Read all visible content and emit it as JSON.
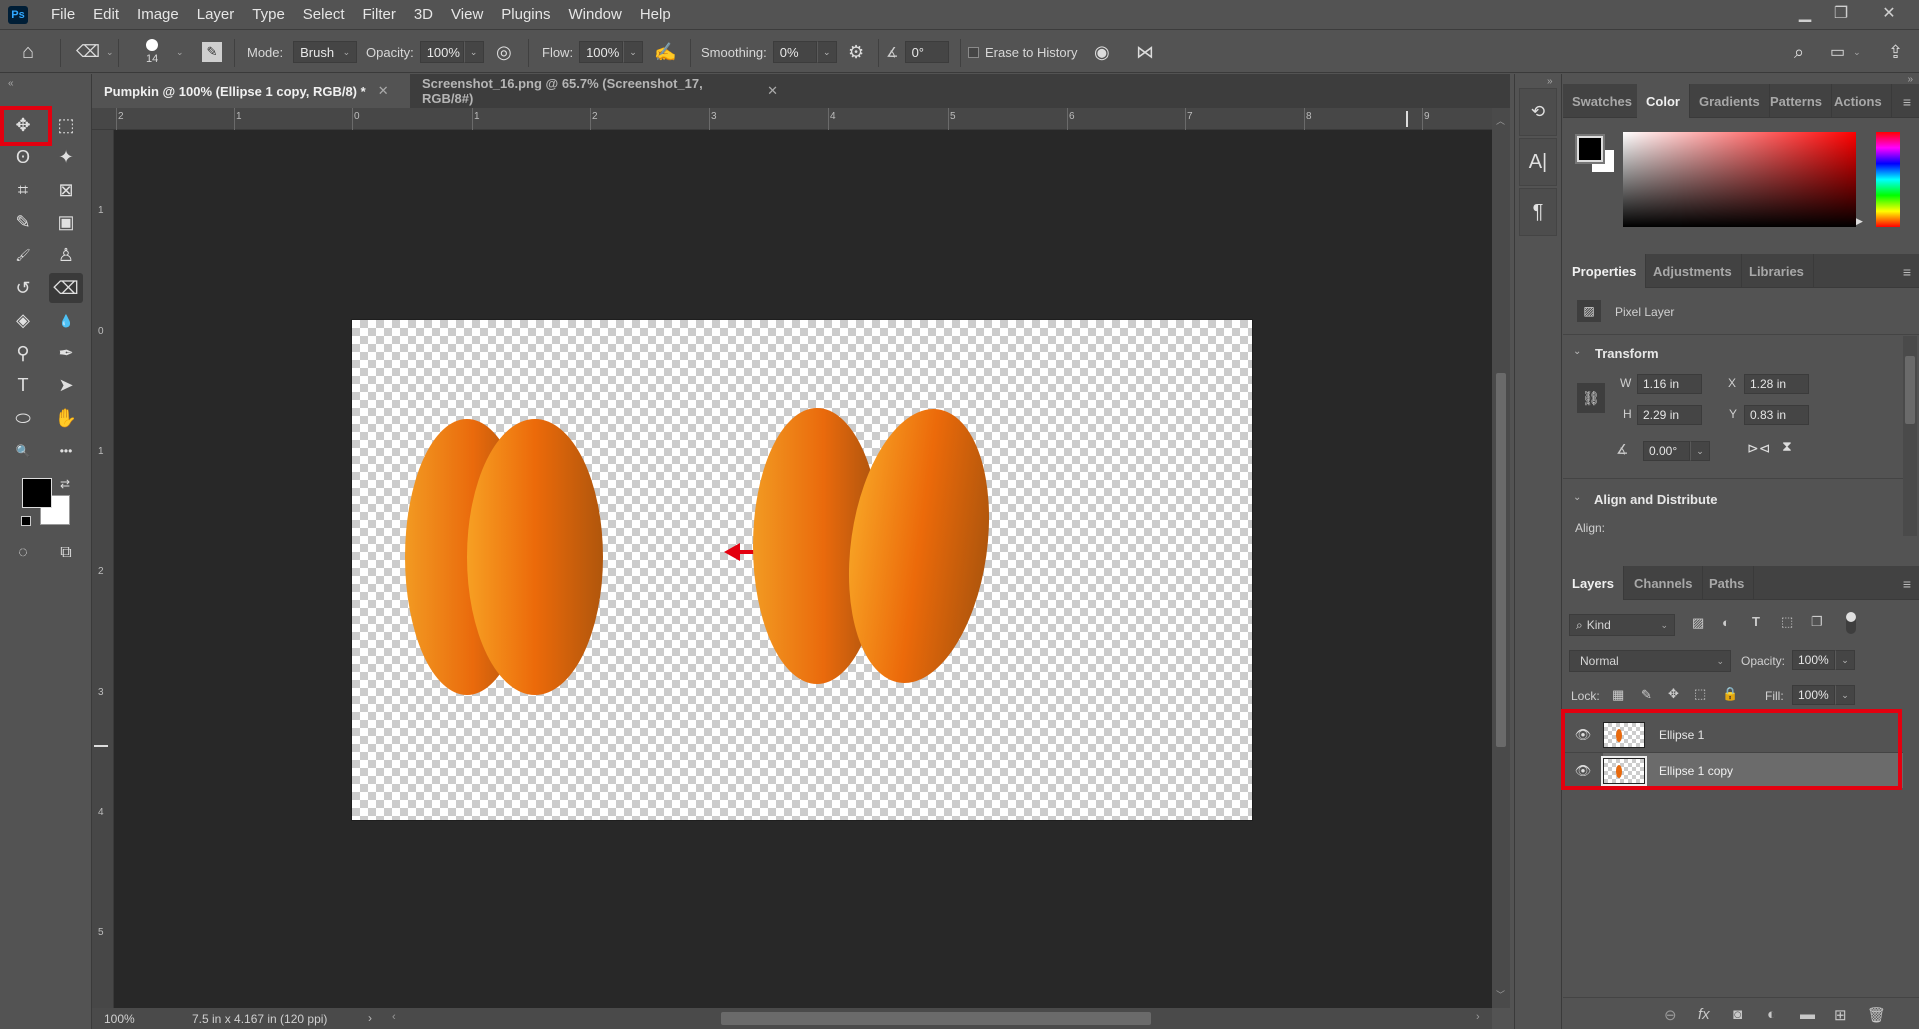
{
  "app": {
    "name": "Photoshop",
    "logo": "Ps"
  },
  "menu": [
    "File",
    "Edit",
    "Image",
    "Layer",
    "Type",
    "Select",
    "Filter",
    "3D",
    "View",
    "Plugins",
    "Window",
    "Help"
  ],
  "window_controls": {
    "minimize": "minimize-icon",
    "restore": "restore-icon",
    "close": "close-icon"
  },
  "options_bar": {
    "brush_size": "14",
    "mode_label": "Mode:",
    "mode_value": "Brush",
    "opacity_label": "Opacity:",
    "opacity_value": "100%",
    "flow_label": "Flow:",
    "flow_value": "100%",
    "smoothing_label": "Smoothing:",
    "smoothing_value": "0%",
    "angle_value": "0°",
    "erase_to_history_label": "Erase to History",
    "erase_to_history_checked": false
  },
  "doc_tabs": [
    {
      "label": "Pumpkin @ 100% (Ellipse 1 copy, RGB/8) *",
      "active": true
    },
    {
      "label": "Screenshot_16.png @ 65.7% (Screenshot_17, RGB/8#)",
      "active": false
    }
  ],
  "tools": [
    {
      "name": "move-tool",
      "glyph": "✥",
      "selected": true
    },
    {
      "name": "rectangular-marquee-tool",
      "glyph": "⬚"
    },
    {
      "name": "lasso-tool",
      "glyph": "ʘ"
    },
    {
      "name": "magic-wand-tool",
      "glyph": "✦"
    },
    {
      "name": "crop-tool",
      "glyph": "⌗"
    },
    {
      "name": "frame-tool",
      "glyph": "⊠"
    },
    {
      "name": "eyedropper-tool",
      "glyph": "✎"
    },
    {
      "name": "object-selection-tool",
      "glyph": "▣"
    },
    {
      "name": "brush-tool",
      "glyph": "🖌"
    },
    {
      "name": "clone-stamp-tool",
      "glyph": "♙"
    },
    {
      "name": "history-brush-tool",
      "glyph": "↺"
    },
    {
      "name": "eraser-tool",
      "glyph": "⌫",
      "active": true
    },
    {
      "name": "paint-bucket-tool",
      "glyph": "◈"
    },
    {
      "name": "blur-tool",
      "glyph": "💧"
    },
    {
      "name": "dodge-tool",
      "glyph": "⚲"
    },
    {
      "name": "pen-tool",
      "glyph": "✒"
    },
    {
      "name": "type-tool",
      "glyph": "T"
    },
    {
      "name": "path-selection-tool",
      "glyph": "➤"
    },
    {
      "name": "ellipse-tool",
      "glyph": "⬭"
    },
    {
      "name": "hand-tool",
      "glyph": "✋"
    },
    {
      "name": "zoom-tool",
      "glyph": "🔍"
    },
    {
      "name": "more-tools",
      "glyph": "•••"
    }
  ],
  "colors": {
    "foreground": "#000000",
    "background": "#ffffff",
    "highlight": "#e3000f",
    "arrow": "#e3000f",
    "pumpkin_light": "#f7a023",
    "pumpkin_mid": "#ec6a0a",
    "pumpkin_dark": "#b0560c"
  },
  "rulers": {
    "horizontal": [
      "2",
      "1",
      "0",
      "1",
      "2",
      "3",
      "4",
      "5",
      "6",
      "7",
      "8",
      "9"
    ],
    "vertical": [
      "1",
      "0",
      "1",
      "2",
      "3",
      "4",
      "5"
    ]
  },
  "status_bar": {
    "zoom": "100%",
    "doc_info": "7.5 in x 4.167 in (120 ppi)"
  },
  "color_panel": {
    "tabs": [
      "Swatches",
      "Color",
      "Gradients",
      "Patterns",
      "Actions"
    ],
    "active_tab": "Color"
  },
  "properties_panel": {
    "tabs": [
      "Properties",
      "Adjustments",
      "Libraries"
    ],
    "active_tab": "Properties",
    "layer_kind": "Pixel Layer",
    "transform_title": "Transform",
    "w_label": "W",
    "w_value": "1.16 in",
    "h_label": "H",
    "h_value": "2.29 in",
    "x_label": "X",
    "x_value": "1.28 in",
    "y_label": "Y",
    "y_value": "0.83 in",
    "angle_value": "0.00°",
    "align_title": "Align and Distribute",
    "align_label": "Align:"
  },
  "layers_panel": {
    "tabs": [
      "Layers",
      "Channels",
      "Paths"
    ],
    "active_tab": "Layers",
    "filter_kind": "Kind",
    "blend_mode": "Normal",
    "opacity_label": "Opacity:",
    "opacity_value": "100%",
    "lock_label": "Lock:",
    "fill_label": "Fill:",
    "fill_value": "100%",
    "layers": [
      {
        "name": "Ellipse 1",
        "visible": true,
        "selected": false
      },
      {
        "name": "Ellipse 1 copy",
        "visible": true,
        "selected": true
      }
    ]
  }
}
